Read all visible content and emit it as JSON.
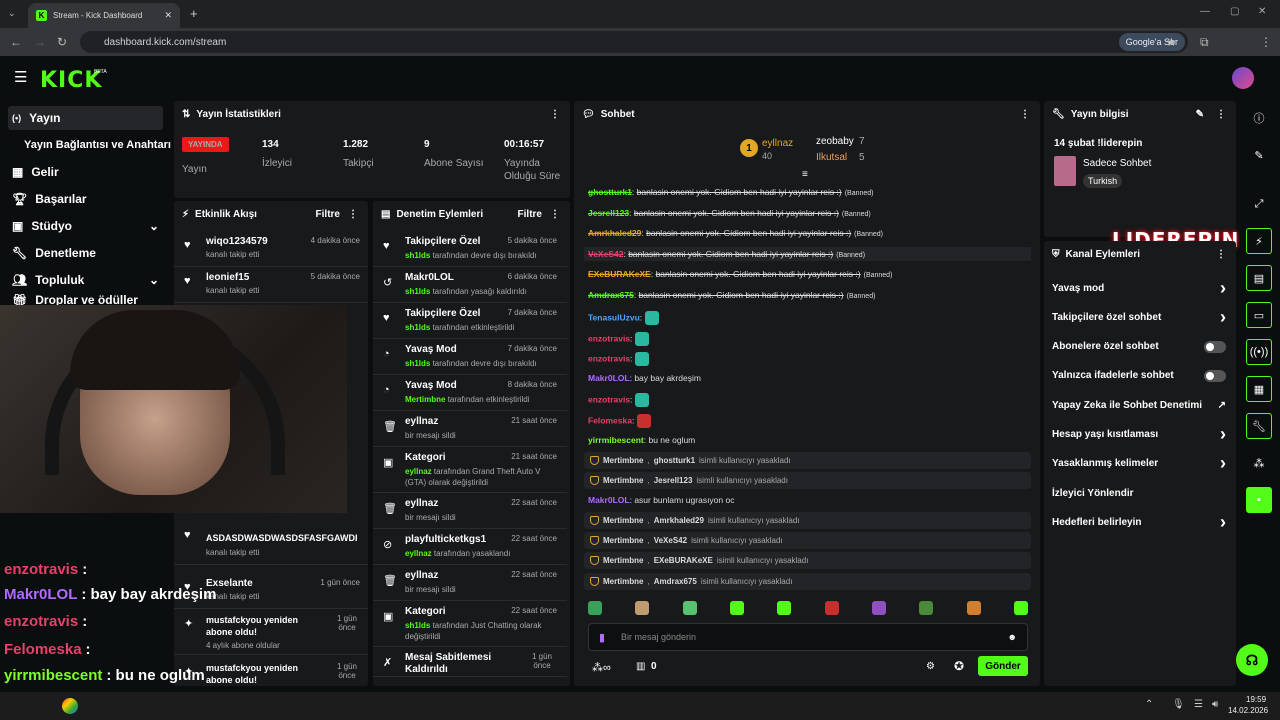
{
  "browser": {
    "tab_title": "Stream - Kick Dashboard",
    "url": "dashboard.kick.com/stream",
    "google_button": "Google'a Sor"
  },
  "brand": {
    "logo": "KICK",
    "beta": "BETA",
    "accent": "#53fc18"
  },
  "sidebar": {
    "items": [
      {
        "label": "Yayın",
        "icon": "broadcast-icon"
      },
      {
        "label": "Yayın Bağlantısı ve Anahtarı",
        "icon": ""
      },
      {
        "label": "Gelir",
        "icon": "revenue-icon"
      },
      {
        "label": "Başarılar",
        "icon": "trophy-icon"
      },
      {
        "label": "Stüdyo",
        "icon": "studio-icon"
      },
      {
        "label": "Denetleme",
        "icon": "wrench-icon"
      },
      {
        "label": "Topluluk",
        "icon": "community-icon"
      },
      {
        "label": "Droplar ve ödüller",
        "icon": "gift-icon"
      }
    ]
  },
  "stats": {
    "title": "Yayın İstatistikleri",
    "live_badge": "YAYINDA",
    "live_label": "Yayın",
    "viewers": "134",
    "viewers_label": "İzleyici",
    "followers": "1.282",
    "followers_label": "Takipçi",
    "subs": "9",
    "subs_label": "Abone Sayısı",
    "uptime": "00:16:57",
    "uptime_label_1": "Yayında",
    "uptime_label_2": "Olduğu Süre"
  },
  "activity": {
    "title": "Etkinlik Akışı",
    "filter": "Filtre",
    "rows": [
      {
        "name": "wiqo1234579",
        "sub": "kanalı takip etti",
        "time": "4 dakika önce"
      },
      {
        "name": "leonief15",
        "sub": "kanalı takip etti",
        "time": "5 dakika önce"
      },
      {
        "name": "ASDASDWASDWASDSFASFGAWDI",
        "sub": "kanalı takip etti",
        "time": ""
      },
      {
        "name": "Exselante",
        "sub": "kanalı takip etti",
        "time": "1 gün önce"
      },
      {
        "name": "mustafckyou yeniden abone oldu!",
        "sub": "4 aylık abone oldular",
        "time": "1 gün önce"
      },
      {
        "name": "mustafckyou yeniden abone oldu!",
        "sub": "",
        "time": "1 gün önce"
      }
    ]
  },
  "moderation": {
    "title": "Denetim Eylemleri",
    "filter": "Filtre",
    "rows": [
      {
        "title": "Takipçilere Özel",
        "actor": "sh1lds",
        "desc": "tarafından devre dışı bırakıldı",
        "time": "5 dakika önce"
      },
      {
        "title": "Makr0LOL",
        "actor": "sh1lds",
        "desc": "tarafından yasağı kaldırıldı",
        "time": "6 dakika önce"
      },
      {
        "title": "Takipçilere Özel",
        "actor": "sh1lds",
        "desc": "tarafından etkinleştirildi",
        "time": "7 dakika önce"
      },
      {
        "title": "Yavaş Mod",
        "actor": "sh1lds",
        "desc": "tarafından devre dışı bırakıldı",
        "time": "7 dakika önce"
      },
      {
        "title": "Yavaş Mod",
        "actor": "Mertimbne",
        "desc": "tarafından etkinleştirildi",
        "time": "8 dakika önce"
      },
      {
        "title": "eyllnaz",
        "actor": "",
        "desc": "bir mesajı sildi",
        "time": "21 saat önce"
      },
      {
        "title": "Kategori",
        "actor": "eyllnaz",
        "desc": "tarafından Grand Theft Auto V (GTA) olarak değiştirildi",
        "time": "21 saat önce"
      },
      {
        "title": "eyllnaz",
        "actor": "",
        "desc": "bir mesajı sildi",
        "time": "22 saat önce"
      },
      {
        "title": "playfulticketkgs1",
        "actor": "eyllnaz",
        "desc": "tarafından yasaklandı",
        "time": "22 saat önce"
      },
      {
        "title": "eyllnaz",
        "actor": "",
        "desc": "bir mesajı sildi",
        "time": "22 saat önce"
      },
      {
        "title": "Kategori",
        "actor": "sh1lds",
        "desc": "tarafından Just Chatting olarak değiştirildi",
        "time": "22 saat önce"
      },
      {
        "title": "Mesaj Sabitlemesi Kaldırıldı",
        "actor": "",
        "desc": "",
        "time": "1 gün önce"
      }
    ]
  },
  "chat": {
    "title": "Sohbet",
    "leaders": [
      {
        "rank": "1",
        "name": "eyllnaz",
        "value": "40"
      },
      {
        "name": "zeobaby",
        "value": "7"
      },
      {
        "name": "Ilkutsal",
        "value": "5"
      }
    ],
    "banned_text": "banlasin onemi yok. Gidiom ben hadi iyi yayinlar reis :)",
    "banned_tag": "(Banned)",
    "banned_users": [
      "ghostturk1",
      "Jesrell123",
      "Amrkhaled29",
      "VeXeS42",
      "EXeBURAKeXE",
      "Amdrax675"
    ],
    "messages": [
      {
        "user": "TenasulUzvu",
        "text": "",
        "emote": true
      },
      {
        "user": "enzotravis",
        "text": "",
        "emote": true
      },
      {
        "user": "enzotravis",
        "text": "",
        "emote": true
      },
      {
        "user": "Makr0LOL",
        "text": "bay bay akrdeşim",
        "emote": false
      },
      {
        "user": "enzotravis",
        "text": "",
        "emote": true
      },
      {
        "user": "Felomeska",
        "text": "",
        "emote": true
      },
      {
        "user": "yirrmibescent",
        "text": "bu ne oglum",
        "emote": false
      }
    ],
    "system": [
      {
        "mod": "Mertimbne",
        "target": "ghostturk1",
        "text": "isimli kullanıcıyı yasakladı"
      },
      {
        "mod": "Mertimbne",
        "target": "Jesrell123",
        "text": "isimli kullanıcıyı yasakladı"
      }
    ],
    "mid_msg": {
      "user": "Makr0LOL",
      "text": "asur bunlamı ugrasıyon oc"
    },
    "system2": [
      {
        "mod": "Mertimbne",
        "target": "Amrkhaled29",
        "text": "isimli kullanıcıyı yasakladı"
      },
      {
        "mod": "Mertimbne",
        "target": "VeXeS42",
        "text": "isimli kullanıcıyı yasakladı"
      },
      {
        "mod": "Mertimbne",
        "target": "EXeBURAKeXE",
        "text": "isimli kullanıcıyı yasakladı"
      },
      {
        "mod": "Mertimbne",
        "target": "Amdrax675",
        "text": "isimli kullanıcıyı yasakladı"
      }
    ],
    "input_placeholder": "Bir mesaj gönderin",
    "points": "0",
    "send": "Gönder"
  },
  "stream_info": {
    "title": "Yayın bilgisi",
    "stream_title": "14 şubat !liderepin",
    "mode": "Sadece Sohbet",
    "language": "Turkish"
  },
  "watermark": "LIDEREPIN",
  "channel_actions": {
    "title": "Kanal Eylemleri",
    "rows": [
      {
        "label": "Yavaş mod",
        "type": "chevron"
      },
      {
        "label": "Takipçilere özel sohbet",
        "type": "chevron"
      },
      {
        "label": "Abonelere özel sohbet",
        "type": "toggle"
      },
      {
        "label": "Yalnızca ifadelerle sohbet",
        "type": "toggle"
      },
      {
        "label": "Yapay Zeka ile Sohbet Denetimi",
        "type": "external"
      },
      {
        "label": "Hesap yaşı kısıtlaması",
        "type": "chevron"
      },
      {
        "label": "Yasaklanmış kelimeler",
        "type": "chevron"
      },
      {
        "label": "İzleyici Yönlendir",
        "type": "none"
      },
      {
        "label": "Hedefleri belirleyin",
        "type": "chevron"
      }
    ]
  },
  "overlay_chat": [
    {
      "user": "enzotravis",
      "text": ":",
      "color": "#e8406b"
    },
    {
      "user": "Makr0LOL",
      "text": ": bay bay akrdeşim",
      "color": "#b06bff"
    },
    {
      "user": "enzotravis",
      "text": ":",
      "color": "#e8406b"
    },
    {
      "user": "Felomeska",
      "text": ":",
      "color": "#e8406b"
    },
    {
      "user": "yirrmibescent",
      "text": ": bu ne oglum",
      "color": "#7fff2a"
    },
    {
      "user": "Makr0LOL",
      "text": ": asur bunlamı ugrasıyon oc",
      "color": "#b06bff"
    }
  ],
  "taskbar": {
    "time": "19:59",
    "date": "14.02.2026"
  }
}
